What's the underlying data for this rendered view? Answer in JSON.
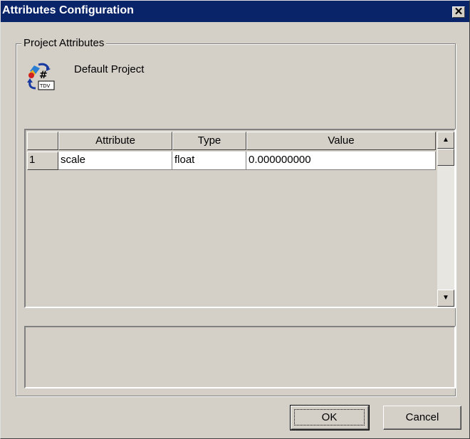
{
  "window": {
    "title": "Attributes Configuration",
    "close_glyph": "✕"
  },
  "group": {
    "legend": "Project Attributes"
  },
  "project": {
    "name": "Default Project",
    "icon": "project-attributes-icon"
  },
  "grid": {
    "columns": [
      "Attribute",
      "Type",
      "Value"
    ],
    "rows": [
      {
        "num": "1",
        "attribute": "scale",
        "type": "float",
        "value": "0.000000000"
      }
    ]
  },
  "scrollbar": {
    "up": "▲",
    "down": "▼"
  },
  "buttons": {
    "ok": "OK",
    "cancel": "Cancel"
  },
  "colors": {
    "titlebar": "#0a246a",
    "face": "#d4d0c8"
  }
}
